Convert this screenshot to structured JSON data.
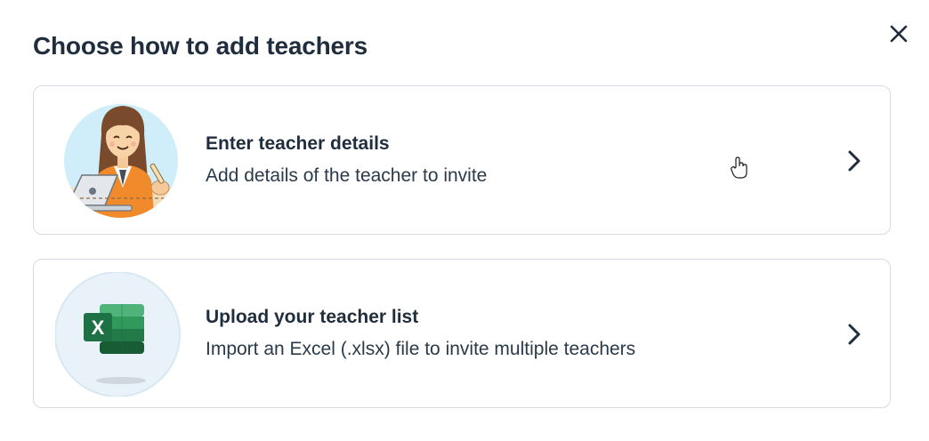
{
  "dialog": {
    "title": "Choose how to add teachers",
    "close_icon": "close-icon",
    "options": [
      {
        "title": "Enter teacher details",
        "description": "Add details of the teacher to invite",
        "icon": "teacher-illustration",
        "chevron_icon": "chevron-right-icon"
      },
      {
        "title": "Upload your teacher list",
        "description": "Import an Excel (.xlsx) file to invite multiple teachers",
        "icon": "excel-icon",
        "chevron_icon": "chevron-right-icon"
      }
    ]
  },
  "colors": {
    "text_primary": "#1f2d3d",
    "border": "#d6dbe1",
    "excel_green": "#1e7145",
    "illustration_sky": "#cfeefa"
  }
}
